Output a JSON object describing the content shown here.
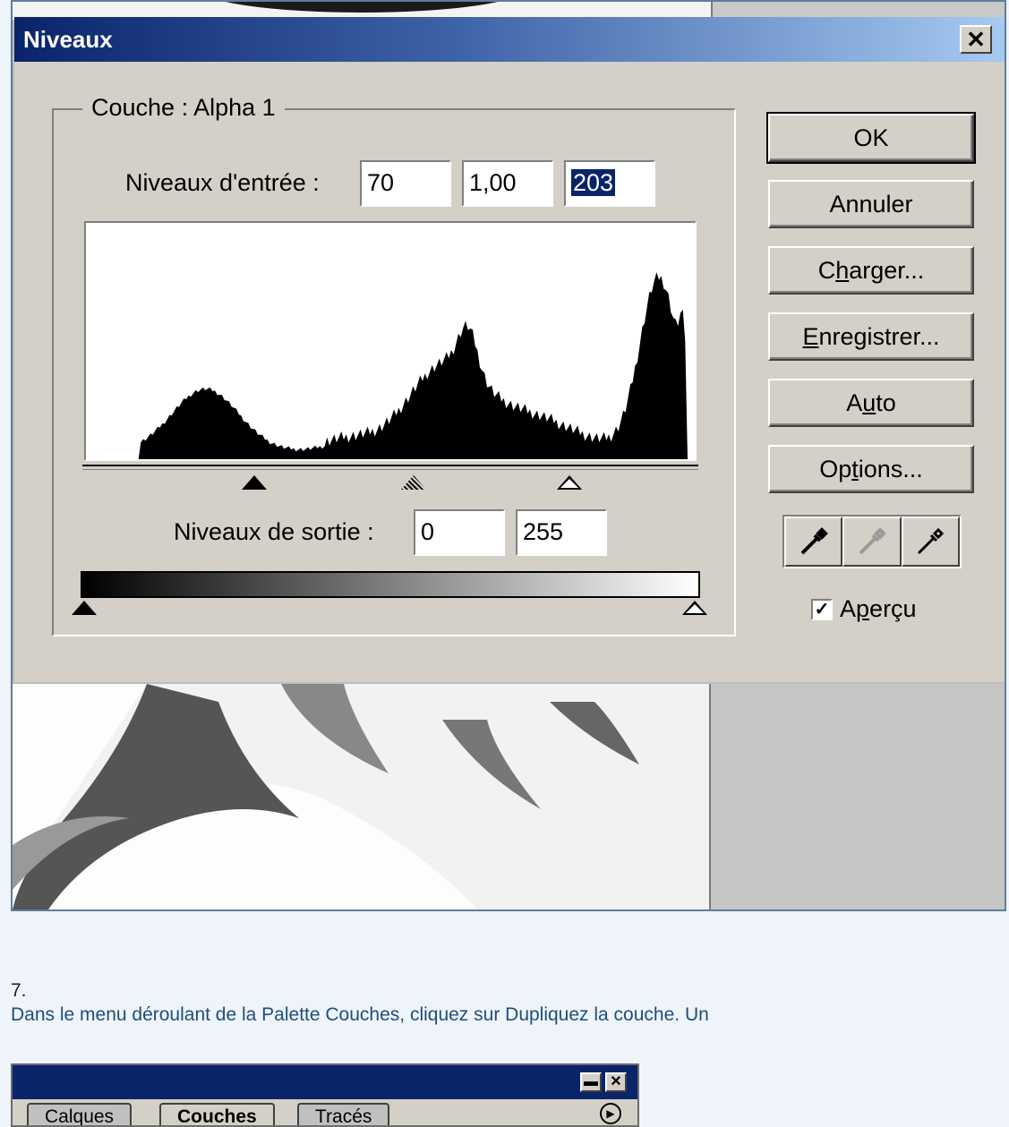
{
  "dialog": {
    "title": "Niveaux",
    "close_glyph": "✕",
    "group_label": "Couche : Alpha 1",
    "input_levels_label": "Niveaux d'entrée :",
    "input_black": "70",
    "input_gamma": "1,00",
    "input_white": "203",
    "output_levels_label": "Niveaux de sortie :",
    "output_black": "0",
    "output_white": "255",
    "buttons": {
      "ok": "OK",
      "cancel": "Annuler",
      "load_pre": "C",
      "load_u": "h",
      "load_post": "arger...",
      "save_pre": "",
      "save_u": "E",
      "save_post": "nregistrer...",
      "auto_pre": "A",
      "auto_u": "u",
      "auto_post": "to",
      "options_pre": "Op",
      "options_u": "t",
      "options_post": "ions..."
    },
    "preview_label_pre": "A",
    "preview_label_u": "p",
    "preview_label_post": "erçu",
    "preview_checked": true,
    "input_slider_values": {
      "black": 70,
      "gamma": 1.0,
      "white": 203
    },
    "output_slider_values": {
      "black": 0,
      "white": 255
    }
  },
  "step": {
    "number": "7.",
    "text": "Dans le menu déroulant de la Palette Couches, cliquez sur Dupliquez la couche. Un"
  },
  "palette": {
    "tabs": [
      "Calques",
      "Couches",
      "Tracés"
    ],
    "active_tab": "Couches"
  },
  "colors": {
    "dialog_bg": "#d4d0c8",
    "title_start": "#0a246a",
    "title_end": "#a6caf0",
    "step_text": "#1f4e79"
  }
}
